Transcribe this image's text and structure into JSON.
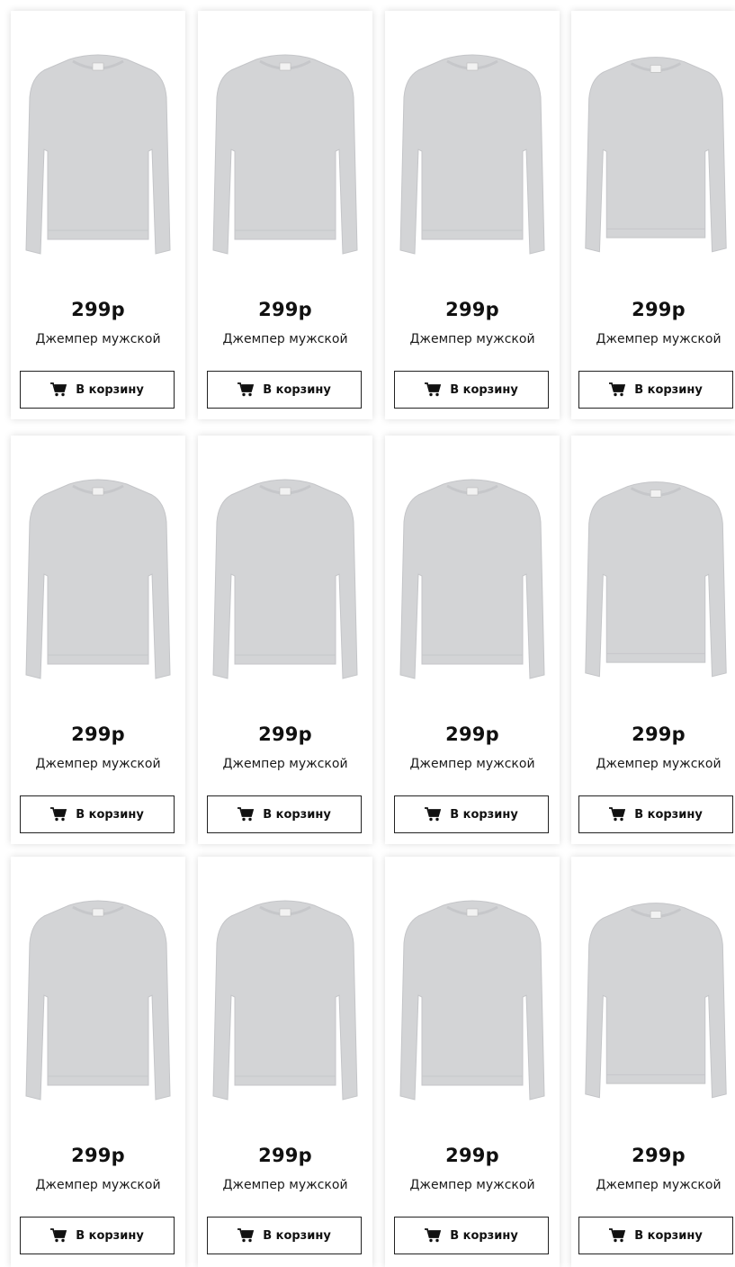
{
  "products": [
    {
      "price": "299р",
      "title": "Джемпер мужской",
      "button_label": "В корзину"
    },
    {
      "price": "299р",
      "title": "Джемпер мужской",
      "button_label": "В корзину"
    },
    {
      "price": "299р",
      "title": "Джемпер мужской",
      "button_label": "В корзину"
    },
    {
      "price": "299р",
      "title": "Джемпер мужской",
      "button_label": "В корзину"
    },
    {
      "price": "299р",
      "title": "Джемпер мужской",
      "button_label": "В корзину"
    },
    {
      "price": "299р",
      "title": "Джемпер мужской",
      "button_label": "В корзину"
    },
    {
      "price": "299р",
      "title": "Джемпер мужской",
      "button_label": "В корзину"
    },
    {
      "price": "299р",
      "title": "Джемпер мужской",
      "button_label": "В корзину"
    },
    {
      "price": "299р",
      "title": "Джемпер мужской",
      "button_label": "В корзину"
    },
    {
      "price": "299р",
      "title": "Джемпер мужской",
      "button_label": "В корзину"
    },
    {
      "price": "299р",
      "title": "Джемпер мужской",
      "button_label": "В корзину"
    },
    {
      "price": "299р",
      "title": "Джемпер мужской",
      "button_label": "В корзину"
    }
  ],
  "icons": {
    "cart": "cart-icon",
    "product_image": "sweater-image"
  },
  "colors": {
    "card_background": "#ffffff",
    "sweater": "#d3d4d6",
    "text": "#111111",
    "button_border": "#222222"
  }
}
